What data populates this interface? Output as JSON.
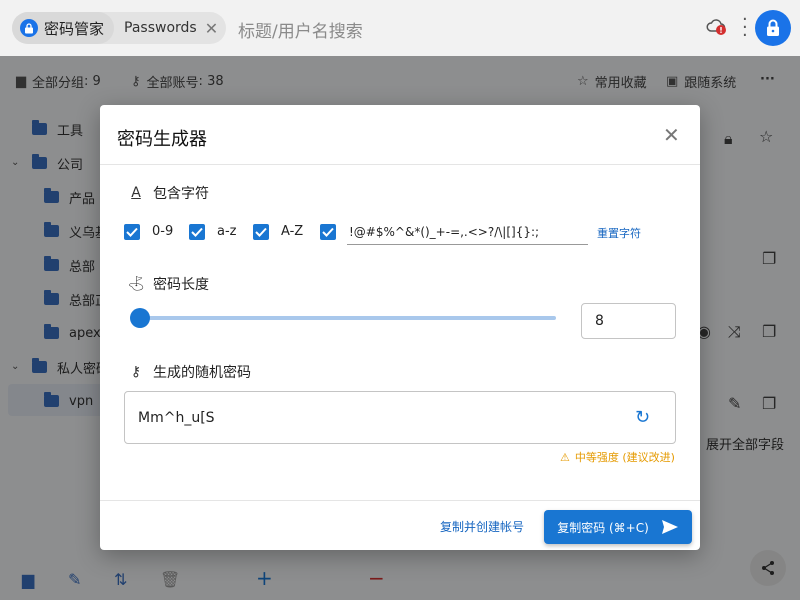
{
  "topbar": {
    "app_tab_label": "密码管家",
    "passwords_tab_label": "Passwords",
    "search_placeholder": "标题/用户名搜索"
  },
  "subbar": {
    "groups_label": "全部分组",
    "groups_count": "9",
    "accounts_label": "全部账号",
    "accounts_count": "38",
    "favorites_label": "常用收藏",
    "sync_label": "跟随系统"
  },
  "tree": {
    "items": [
      {
        "label": "工具"
      },
      {
        "label": "公司"
      },
      {
        "label": "产品"
      },
      {
        "label": "义乌基"
      },
      {
        "label": "总部"
      },
      {
        "label": "总部正"
      },
      {
        "label": "apex"
      },
      {
        "label": "私人密码"
      },
      {
        "label": "vpn"
      }
    ]
  },
  "right_panel": {
    "expand_all_label": "展开全部字段"
  },
  "dialog": {
    "title": "密码生成器",
    "include_chars_label": "包含字符",
    "checkboxes": [
      {
        "label": "0-9",
        "checked": true
      },
      {
        "label": "a-z",
        "checked": true
      },
      {
        "label": "A-Z",
        "checked": true
      },
      {
        "label": "",
        "checked": true
      }
    ],
    "special_chars_value": "!@#$%^&*()_+-=,.<>?/\\|[]{}:;",
    "reset_chars_label": "重置字符",
    "length_label": "密码长度",
    "length_value": "8",
    "length_fraction": 0.0,
    "generated_label": "生成的随机密码",
    "generated_password": "Mm^h_u[S",
    "strength_text": "中等强度 (建议改进)",
    "copy_create_label": "复制并创建帐号",
    "copy_button_label": "复制密码 (⌘+C)"
  },
  "colors": {
    "accent": "#1976d2",
    "warning": "#e59a00",
    "badge_red": "#d32f2f"
  }
}
